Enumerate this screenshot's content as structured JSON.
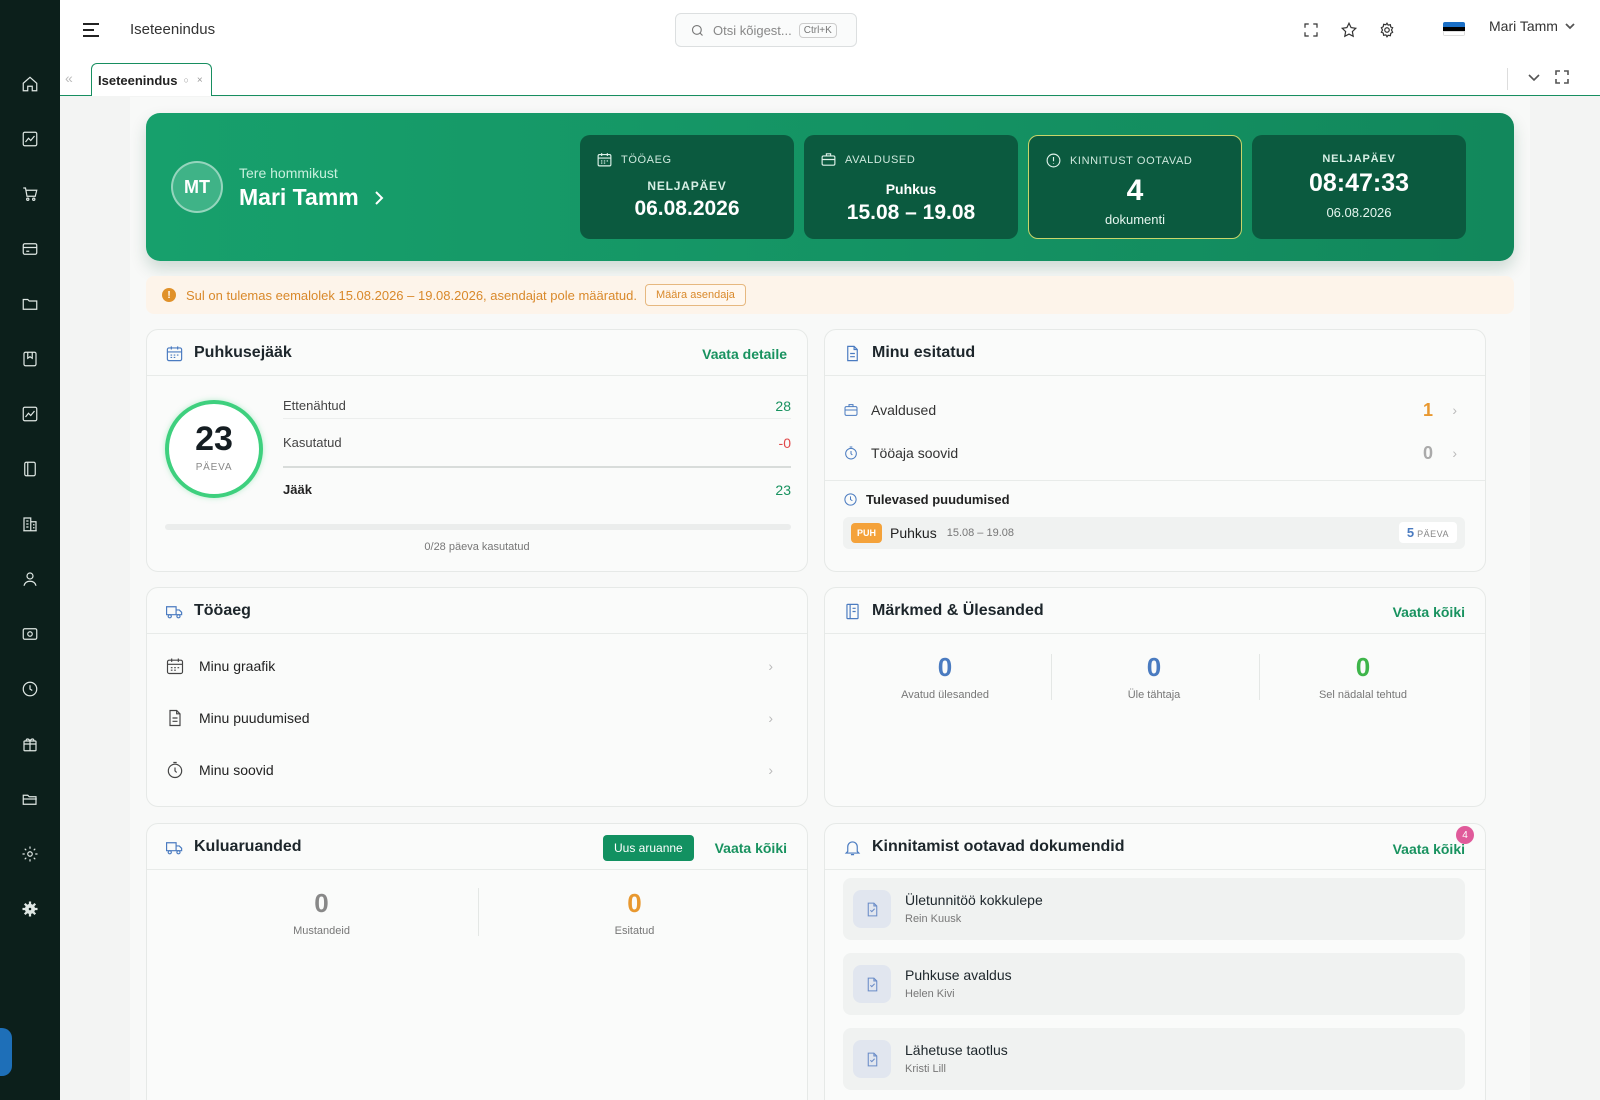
{
  "colors": {
    "brand": "#129161",
    "orange": "#e0912a",
    "red": "#e0484a",
    "blue": "#4a7bc0",
    "lime": "#3eb54a",
    "sidebar": "#0c1f1b"
  },
  "sidebar": {
    "icons": [
      "home-icon",
      "chart-icon",
      "cart-icon",
      "card-icon",
      "folder-icon",
      "book-icon",
      "chart-icon-2",
      "ledger-icon",
      "building-icon",
      "user-icon",
      "money-icon",
      "clock-icon",
      "gift-icon",
      "folder-open-icon",
      "settings-icon",
      "settings-filled-icon"
    ]
  },
  "topbar": {
    "title": "Iseteenindus",
    "search": {
      "placeholder": "Otsi kõigest...",
      "shortcut": "Ctrl+K"
    },
    "user_name": "Mari Tamm"
  },
  "tabs": [
    {
      "label": "Iseteenindus",
      "reload": "○",
      "close": "×"
    }
  ],
  "hero": {
    "avatar_initials": "MT",
    "greeting": "Tere hommikust",
    "name": "Mari Tamm",
    "cards": [
      {
        "label": "TÖÖAEG",
        "sub": "NELJAPÄEV",
        "value": "06.08.2026"
      },
      {
        "label": "AVALDUSED",
        "sub": "Puhkus",
        "value": "15.08 – 19.08"
      },
      {
        "label": "KINNITUST OOTAVAD",
        "value": "4",
        "sub": "dokumenti"
      },
      {
        "sub": "NELJAPÄEV",
        "value": "08:47:33",
        "date": "06.08.2026"
      }
    ]
  },
  "alert": {
    "message": "Sul on tulemas eemalolek 15.08.2026 – 19.08.2026, asendajat pole määratud.",
    "button": "Määra asendaja"
  },
  "vacation_balance": {
    "title": "Puhkusejääk",
    "link": "Vaata detaile",
    "days": "23",
    "days_label": "PÄEVA",
    "rows": [
      {
        "label": "Ettenähtud",
        "value": "28"
      },
      {
        "label": "Kasutatud",
        "value": "-0"
      },
      {
        "label": "Jääk",
        "value": "23"
      }
    ],
    "used_fraction": 0,
    "progress_text": "0/28 päeva kasutatud"
  },
  "my_submitted": {
    "title": "Minu esitatud",
    "rows": [
      {
        "label": "Avaldused",
        "value": "1"
      },
      {
        "label": "Tööaja soovid",
        "value": "0"
      }
    ],
    "upcoming_title": "Tulevased puudumised",
    "absences": [
      {
        "badge": "PUH",
        "name": "Puhkus",
        "dates": "15.08 – 19.08",
        "days": "5",
        "days_label": "PÄEVA"
      }
    ]
  },
  "worktime": {
    "title": "Tööaeg",
    "items": [
      {
        "label": "Minu graafik"
      },
      {
        "label": "Minu puudumised"
      },
      {
        "label": "Minu soovid"
      }
    ]
  },
  "notes_tasks": {
    "title": "Märkmed & Ülesanded",
    "link": "Vaata kõiki",
    "stats": [
      {
        "value": "0",
        "label": "Avatud ülesanded"
      },
      {
        "value": "0",
        "label": "Üle tähtaja"
      },
      {
        "value": "0",
        "label": "Sel nädalal tehtud"
      }
    ]
  },
  "expense_reports": {
    "title": "Kuluaruanded",
    "new_button": "Uus aruanne",
    "link": "Vaata kõiki",
    "stats": [
      {
        "value": "0",
        "label": "Mustandeid"
      },
      {
        "value": "0",
        "label": "Esitatud"
      }
    ]
  },
  "pending_docs": {
    "title": "Kinnitamist ootavad dokumendid",
    "link": "Vaata kõiki",
    "count": "4",
    "items": [
      {
        "title": "Ületunnitöö kokkulepe",
        "person": "Rein Kuusk"
      },
      {
        "title": "Puhkuse avaldus",
        "person": "Helen Kivi"
      },
      {
        "title": "Lähetuse taotlus",
        "person": "Kristi Lill"
      }
    ]
  }
}
